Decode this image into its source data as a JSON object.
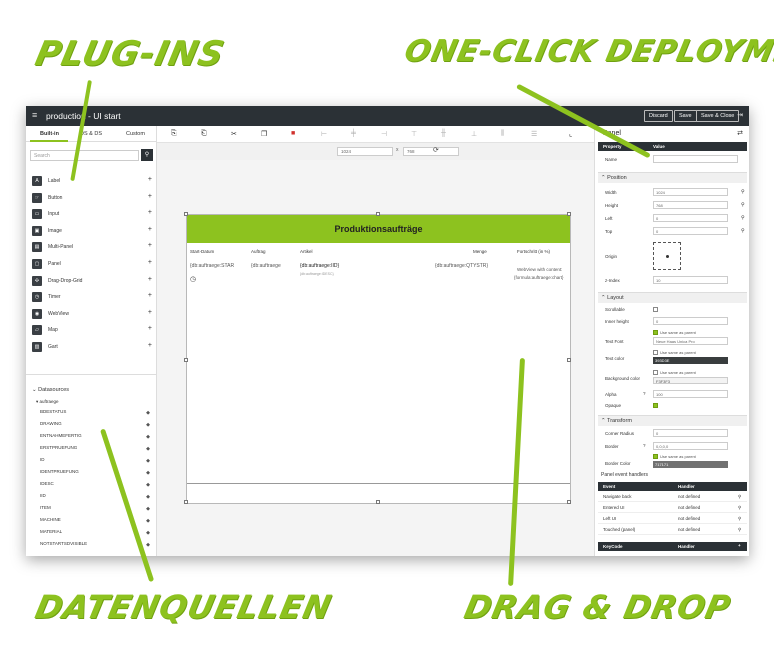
{
  "headlines": {
    "plugins": "PLUG-INS",
    "deployment": "ONE-CLICK DEPLOYMENT",
    "datasources": "DATENQUELLEN",
    "dragdrop": "DRAG & DROP"
  },
  "brand_color": "#8dc21f",
  "window": {
    "title": "production - UI start",
    "buttons": {
      "discard": "Discard",
      "save": "Save",
      "save_close": "Save & Close"
    }
  },
  "sidebar": {
    "tabs": [
      "Built-in",
      "DS & DS",
      "Custom"
    ],
    "search_placeholder": "Search",
    "components": [
      {
        "label": "Label",
        "icon": "A"
      },
      {
        "label": "Button",
        "icon": "☞"
      },
      {
        "label": "Input",
        "icon": "▭"
      },
      {
        "label": "Image",
        "icon": "▣"
      },
      {
        "label": "Multi-Panel",
        "icon": "▤"
      },
      {
        "label": "Panel",
        "icon": "▢"
      },
      {
        "label": "Drag-Drop-Grid",
        "icon": "✣"
      },
      {
        "label": "Timer",
        "icon": "◷"
      },
      {
        "label": "WebView",
        "icon": "◉"
      },
      {
        "label": "Map",
        "icon": "▱"
      },
      {
        "label": "Gart",
        "icon": "▥"
      }
    ],
    "datasources": {
      "header": "Datasources",
      "source": "auftraege",
      "fields": [
        "BDESTATUS",
        "DRAWING",
        "ENTNAHMEFERTIG",
        "ERSTPRUEFUNG",
        "ID",
        "IDENTPRUEFUNG",
        "IDESC",
        "IID",
        "ITEM",
        "MACHINE",
        "MATERIAL",
        "NOTSTARTSDVISIBLE"
      ]
    }
  },
  "size": {
    "width": "1024",
    "height": "768"
  },
  "canvas": {
    "title": "Produktionsaufträge",
    "columns": [
      "Start-Datum",
      "Auftrag",
      "Artikel",
      "Menge",
      "Fortschritt (in %)"
    ],
    "cells": {
      "start": "{db:auftraege:STAR",
      "auftrag": "{db:auftraege",
      "artikel": "{db:auftraege:IID}",
      "artikel_sub": "{db:auftraege:IDESC}",
      "menge": "{db:auftraege:QTYSTR}",
      "fortschritt": "WebView with content:",
      "fortschritt_sub": "{formula:auftraege:chart}"
    }
  },
  "props": {
    "title": "Panel",
    "head": [
      "Property",
      "Value"
    ],
    "name_label": "Name",
    "sections": {
      "position": "Position",
      "layout": "Layout",
      "transform": "Transform",
      "events": "Panel event handlers"
    },
    "position": [
      {
        "label": "Width",
        "value": "1024"
      },
      {
        "label": "Height",
        "value": "768"
      },
      {
        "label": "Left",
        "value": "0"
      },
      {
        "label": "Top",
        "value": "0"
      }
    ],
    "origin_label": "Origin",
    "zindex": {
      "label": "z-Index",
      "value": "10"
    },
    "layout": {
      "scrollable": "Scrollable",
      "inner_height": {
        "label": "Inner height",
        "value": "0"
      },
      "text_font": {
        "label": "Text Font",
        "parent": "Use same as parent",
        "value": "Neue Haas Unica Pro"
      },
      "text_color": {
        "label": "Text color",
        "parent": "Use same as parent",
        "value": "393D3E"
      },
      "bg_color": {
        "label": "Background color",
        "parent": "Use same as parent",
        "value": "F3F3F3"
      },
      "alpha": {
        "label": "Alpha",
        "value": "100"
      },
      "opaque": "Opaque"
    },
    "transform": {
      "corner_radius": {
        "label": "Corner Radius",
        "value": "0"
      },
      "border": {
        "label": "Border",
        "value": "0,0,0,0"
      },
      "border_color": {
        "label": "Border Color",
        "parent": "Use same as parent",
        "value": "717171"
      }
    },
    "events_head": [
      "Event",
      "Handler"
    ],
    "events": [
      {
        "event": "Navigate back",
        "handler": "not defined"
      },
      {
        "event": "Entered UI",
        "handler": "not defined"
      },
      {
        "event": "Left UI",
        "handler": "not defined"
      },
      {
        "event": "Touched (panel)",
        "handler": "not defined"
      }
    ],
    "keycode_head": [
      "KeyCode",
      "Handler"
    ]
  }
}
